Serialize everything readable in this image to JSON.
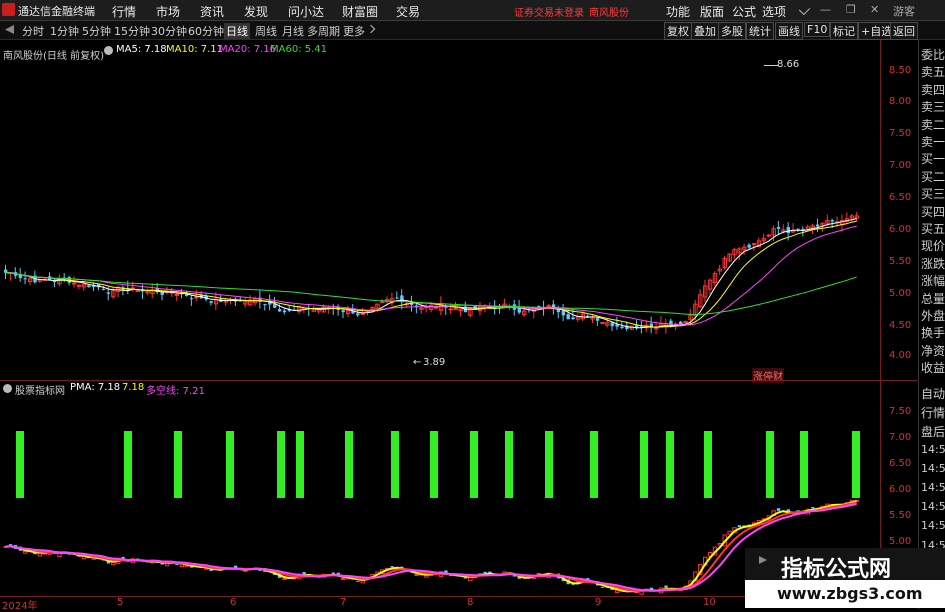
{
  "app": {
    "title": "通达信金融终端",
    "menu": [
      "行情",
      "市场",
      "资讯",
      "发现",
      "问小达",
      "财富圈",
      "交易"
    ],
    "warning": "证券交易未登录",
    "stock_name_top": "南风股份",
    "right_menu": [
      "功能",
      "版面",
      "公式",
      "选项"
    ],
    "guest": "游客"
  },
  "toolbar": {
    "periods": [
      "分时",
      "1分钟",
      "5分钟",
      "15分钟",
      "30分钟",
      "60分钟",
      "日线",
      "周线",
      "月线",
      "多周期",
      "更多"
    ],
    "active_period": "日线",
    "right_buttons": [
      "复权",
      "叠加",
      "多股",
      "统计",
      "画线",
      "F10",
      "标记",
      "+自选",
      "返回"
    ]
  },
  "main_chart": {
    "header_name": "南风股份(日线 前复权)",
    "ma": [
      {
        "label": "MA5: 7.18",
        "color": "#ffffff"
      },
      {
        "label": "MA10: 7.11",
        "color": "#ffff00"
      },
      {
        "label": "MA20: 7.16",
        "color": "#ff44ff"
      },
      {
        "label": "MA60: 5.41",
        "color": "#33dd33"
      }
    ],
    "price_ticks": [
      "8.50",
      "8.00",
      "7.50",
      "7.00",
      "6.50",
      "6.00",
      "5.50",
      "5.00",
      "4.50",
      "4.00"
    ],
    "high_label": "8.66",
    "low_label": "3.89",
    "badge": "涨停财"
  },
  "sub_chart": {
    "header_name": "股票指标网",
    "pma": {
      "label": "PMA: 7.18",
      "color": "#ffffff"
    },
    "val2": {
      "label": "7.18",
      "color": "#ffff00"
    },
    "multi": {
      "label": "多空线: 7.21",
      "color": "#ff44ff"
    },
    "price_ticks": [
      "7.50",
      "7.00",
      "6.50",
      "6.00",
      "5.50",
      "5.00"
    ]
  },
  "time_axis": [
    "2024年",
    "5",
    "6",
    "7",
    "8",
    "9",
    "10"
  ],
  "side_labels_top": [
    "委比",
    "卖五",
    "卖四",
    "卖三",
    "卖二",
    "卖一",
    "买一",
    "买二",
    "买三",
    "买四",
    "买五",
    "现价",
    "涨跌",
    "涨幅",
    "总量",
    "外盘",
    "换手",
    "净资",
    "收益"
  ],
  "side_labels_bottom": [
    "自动",
    "行情",
    "盘后",
    "14:50",
    "14:50",
    "14:50",
    "14:50",
    "14:50",
    "14:50",
    "14:50",
    "14:50"
  ],
  "watermark": {
    "main": "指标公式网",
    "sub": "www.zbgs3.com"
  },
  "colors": {
    "up": "#ff3333",
    "down": "#55ccff",
    "green_bar": "#33ee22",
    "ma60": "#33dd33"
  }
}
